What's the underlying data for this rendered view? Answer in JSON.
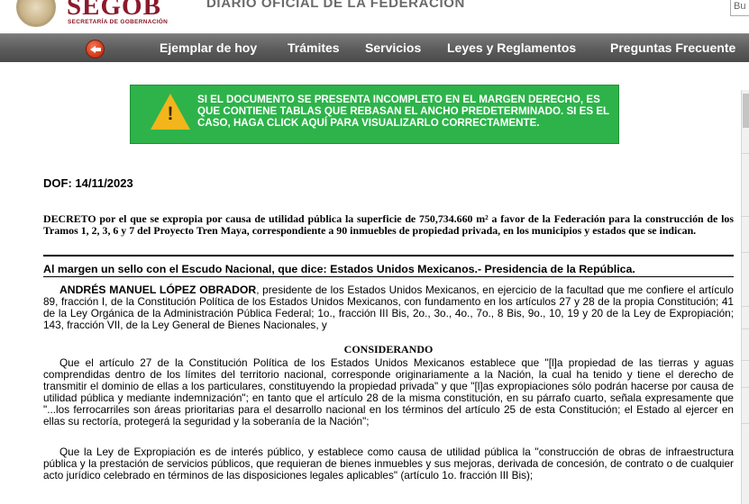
{
  "header": {
    "logo_title": "SEGOB",
    "logo_subtitle": "SECRETARÍA DE GOBERNACIÓN",
    "site_title": "DIARIO OFICIAL DE LA FEDERACIÓN",
    "search_placeholder": "Bu"
  },
  "nav": {
    "items": [
      "Ejemplar de hoy",
      "Trámites",
      "Servicios",
      "Leyes y Reglamentos",
      "Preguntas Frecuente"
    ]
  },
  "warning": {
    "text": "SI EL DOCUMENTO SE PRESENTA INCOMPLETO EN EL MARGEN DERECHO, ES QUE CONTIENE TABLAS QUE REBASAN EL ANCHO PREDETERMINADO. SI ES EL CASO, HAGA CLICK AQUÍ PARA VISUALIZARLO CORRECTAMENTE."
  },
  "document": {
    "date": "DOF: 14/11/2023",
    "decreto": "DECRETO por el que se expropia por causa de utilidad pública la superficie de 750,734.660 m² a favor de la Federación para la construcción de los Tramos 1, 2, 3, 6 y 7 del Proyecto Tren Maya, correspondiente a 90 inmuebles de propiedad privada, en los municipios y estados que se indican.",
    "margen": "Al margen un sello con el Escudo Nacional, que dice: Estados Unidos Mexicanos.- Presidencia de la República.",
    "p1_name": "ANDRÉS MANUEL LÓPEZ OBRADOR",
    "p1_rest": ", presidente de los Estados Unidos Mexicanos, en ejercicio de la facultad que me confiere el artículo 89, fracción I, de la Constitución Política de los Estados Unidos Mexicanos, con fundamento en los artículos 27 y 28 de la propia Constitución; 41 de la Ley Orgánica de la Administración Pública Federal; 1o., fracción III Bis, 2o., 3o., 4o., 7o., 8 Bis, 9o., 10, 19 y 20 de la Ley de Expropiación; 143, fracción VII, de la Ley General de Bienes Nacionales, y",
    "considerando": "CONSIDERANDO",
    "p2": "Que el artículo 27 de la Constitución Política de los Estados Unidos Mexicanos establece que \"[l]a propiedad de las tierras y aguas comprendidas dentro de los límites del territorio nacional, corresponde originariamente a la Nación, la cual ha tenido y tiene el derecho de transmitir el dominio de ellas a los particulares, constituyendo la propiedad privada\" y que \"[l]as expropiaciones sólo podrán hacerse por causa de utilidad pública y mediante indemnización\"; en tanto que el artículo 28 de la misma constitución, en su párrafo cuarto, señala expresamente que \"...los ferrocarriles son áreas prioritarias para el desarrollo nacional en los términos del artículo 25 de esta Constitución; el Estado al ejercer en ellas su rectoría, protegerá la seguridad y la soberanía de la Nación\";",
    "p3": "Que la Ley de Expropiación es de interés público, y establece como causa de utilidad pública la \"construcción de obras de infraestructura pública y la prestación de servicios públicos, que requieran de bienes inmuebles y sus mejoras, derivada de concesión, de contrato o de cualquier acto jurídico celebrado en términos de las disposiciones legales aplicables\" (artículo 1o. fracción III Bis);"
  }
}
